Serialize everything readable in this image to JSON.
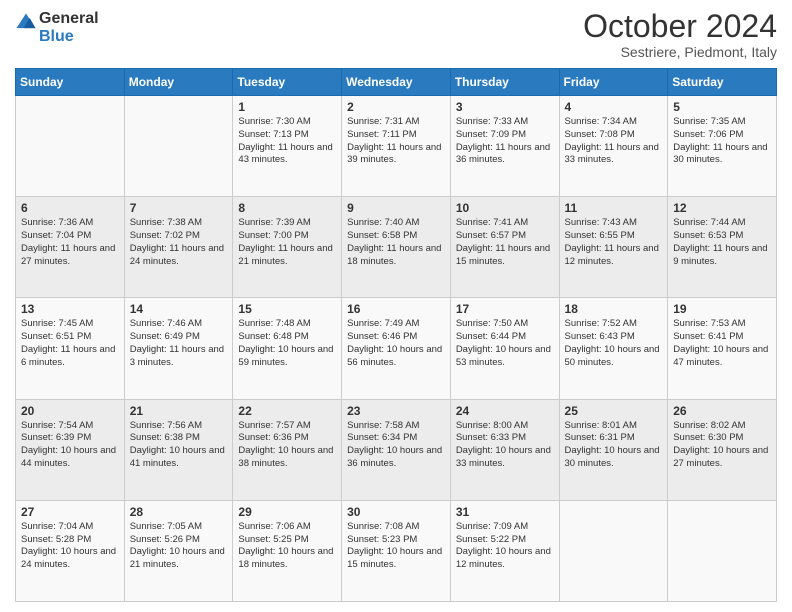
{
  "header": {
    "logo_line1": "General",
    "logo_line2": "Blue",
    "month": "October 2024",
    "location": "Sestriere, Piedmont, Italy"
  },
  "days_of_week": [
    "Sunday",
    "Monday",
    "Tuesday",
    "Wednesday",
    "Thursday",
    "Friday",
    "Saturday"
  ],
  "weeks": [
    [
      {
        "day": "",
        "sunrise": "",
        "sunset": "",
        "daylight": ""
      },
      {
        "day": "",
        "sunrise": "",
        "sunset": "",
        "daylight": ""
      },
      {
        "day": "1",
        "sunrise": "Sunrise: 7:30 AM",
        "sunset": "Sunset: 7:13 PM",
        "daylight": "Daylight: 11 hours and 43 minutes."
      },
      {
        "day": "2",
        "sunrise": "Sunrise: 7:31 AM",
        "sunset": "Sunset: 7:11 PM",
        "daylight": "Daylight: 11 hours and 39 minutes."
      },
      {
        "day": "3",
        "sunrise": "Sunrise: 7:33 AM",
        "sunset": "Sunset: 7:09 PM",
        "daylight": "Daylight: 11 hours and 36 minutes."
      },
      {
        "day": "4",
        "sunrise": "Sunrise: 7:34 AM",
        "sunset": "Sunset: 7:08 PM",
        "daylight": "Daylight: 11 hours and 33 minutes."
      },
      {
        "day": "5",
        "sunrise": "Sunrise: 7:35 AM",
        "sunset": "Sunset: 7:06 PM",
        "daylight": "Daylight: 11 hours and 30 minutes."
      }
    ],
    [
      {
        "day": "6",
        "sunrise": "Sunrise: 7:36 AM",
        "sunset": "Sunset: 7:04 PM",
        "daylight": "Daylight: 11 hours and 27 minutes."
      },
      {
        "day": "7",
        "sunrise": "Sunrise: 7:38 AM",
        "sunset": "Sunset: 7:02 PM",
        "daylight": "Daylight: 11 hours and 24 minutes."
      },
      {
        "day": "8",
        "sunrise": "Sunrise: 7:39 AM",
        "sunset": "Sunset: 7:00 PM",
        "daylight": "Daylight: 11 hours and 21 minutes."
      },
      {
        "day": "9",
        "sunrise": "Sunrise: 7:40 AM",
        "sunset": "Sunset: 6:58 PM",
        "daylight": "Daylight: 11 hours and 18 minutes."
      },
      {
        "day": "10",
        "sunrise": "Sunrise: 7:41 AM",
        "sunset": "Sunset: 6:57 PM",
        "daylight": "Daylight: 11 hours and 15 minutes."
      },
      {
        "day": "11",
        "sunrise": "Sunrise: 7:43 AM",
        "sunset": "Sunset: 6:55 PM",
        "daylight": "Daylight: 11 hours and 12 minutes."
      },
      {
        "day": "12",
        "sunrise": "Sunrise: 7:44 AM",
        "sunset": "Sunset: 6:53 PM",
        "daylight": "Daylight: 11 hours and 9 minutes."
      }
    ],
    [
      {
        "day": "13",
        "sunrise": "Sunrise: 7:45 AM",
        "sunset": "Sunset: 6:51 PM",
        "daylight": "Daylight: 11 hours and 6 minutes."
      },
      {
        "day": "14",
        "sunrise": "Sunrise: 7:46 AM",
        "sunset": "Sunset: 6:49 PM",
        "daylight": "Daylight: 11 hours and 3 minutes."
      },
      {
        "day": "15",
        "sunrise": "Sunrise: 7:48 AM",
        "sunset": "Sunset: 6:48 PM",
        "daylight": "Daylight: 10 hours and 59 minutes."
      },
      {
        "day": "16",
        "sunrise": "Sunrise: 7:49 AM",
        "sunset": "Sunset: 6:46 PM",
        "daylight": "Daylight: 10 hours and 56 minutes."
      },
      {
        "day": "17",
        "sunrise": "Sunrise: 7:50 AM",
        "sunset": "Sunset: 6:44 PM",
        "daylight": "Daylight: 10 hours and 53 minutes."
      },
      {
        "day": "18",
        "sunrise": "Sunrise: 7:52 AM",
        "sunset": "Sunset: 6:43 PM",
        "daylight": "Daylight: 10 hours and 50 minutes."
      },
      {
        "day": "19",
        "sunrise": "Sunrise: 7:53 AM",
        "sunset": "Sunset: 6:41 PM",
        "daylight": "Daylight: 10 hours and 47 minutes."
      }
    ],
    [
      {
        "day": "20",
        "sunrise": "Sunrise: 7:54 AM",
        "sunset": "Sunset: 6:39 PM",
        "daylight": "Daylight: 10 hours and 44 minutes."
      },
      {
        "day": "21",
        "sunrise": "Sunrise: 7:56 AM",
        "sunset": "Sunset: 6:38 PM",
        "daylight": "Daylight: 10 hours and 41 minutes."
      },
      {
        "day": "22",
        "sunrise": "Sunrise: 7:57 AM",
        "sunset": "Sunset: 6:36 PM",
        "daylight": "Daylight: 10 hours and 38 minutes."
      },
      {
        "day": "23",
        "sunrise": "Sunrise: 7:58 AM",
        "sunset": "Sunset: 6:34 PM",
        "daylight": "Daylight: 10 hours and 36 minutes."
      },
      {
        "day": "24",
        "sunrise": "Sunrise: 8:00 AM",
        "sunset": "Sunset: 6:33 PM",
        "daylight": "Daylight: 10 hours and 33 minutes."
      },
      {
        "day": "25",
        "sunrise": "Sunrise: 8:01 AM",
        "sunset": "Sunset: 6:31 PM",
        "daylight": "Daylight: 10 hours and 30 minutes."
      },
      {
        "day": "26",
        "sunrise": "Sunrise: 8:02 AM",
        "sunset": "Sunset: 6:30 PM",
        "daylight": "Daylight: 10 hours and 27 minutes."
      }
    ],
    [
      {
        "day": "27",
        "sunrise": "Sunrise: 7:04 AM",
        "sunset": "Sunset: 5:28 PM",
        "daylight": "Daylight: 10 hours and 24 minutes."
      },
      {
        "day": "28",
        "sunrise": "Sunrise: 7:05 AM",
        "sunset": "Sunset: 5:26 PM",
        "daylight": "Daylight: 10 hours and 21 minutes."
      },
      {
        "day": "29",
        "sunrise": "Sunrise: 7:06 AM",
        "sunset": "Sunset: 5:25 PM",
        "daylight": "Daylight: 10 hours and 18 minutes."
      },
      {
        "day": "30",
        "sunrise": "Sunrise: 7:08 AM",
        "sunset": "Sunset: 5:23 PM",
        "daylight": "Daylight: 10 hours and 15 minutes."
      },
      {
        "day": "31",
        "sunrise": "Sunrise: 7:09 AM",
        "sunset": "Sunset: 5:22 PM",
        "daylight": "Daylight: 10 hours and 12 minutes."
      },
      {
        "day": "",
        "sunrise": "",
        "sunset": "",
        "daylight": ""
      },
      {
        "day": "",
        "sunrise": "",
        "sunset": "",
        "daylight": ""
      }
    ]
  ]
}
